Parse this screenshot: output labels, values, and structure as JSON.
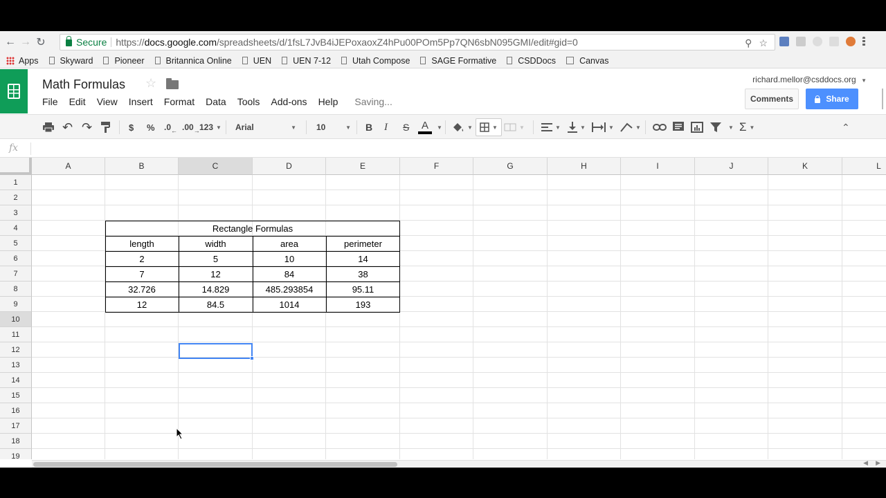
{
  "browser": {
    "secure_label": "Secure",
    "url_scheme": "https://",
    "url_domain": "docs.google.com",
    "url_path": "/spreadsheets/d/1fsL7JvB4iJEPoxaoxZ4hPu00POm5Pp7QN6sbN095GMI/edit#gid=0"
  },
  "bookmarks": [
    "Apps",
    "Skyward",
    "Pioneer",
    "Britannica Online",
    "UEN",
    "UEN 7-12",
    "Utah Compose",
    "SAGE Formative",
    "CSDDocs",
    "Canvas"
  ],
  "doc": {
    "title": "Math Formulas",
    "user_email": "richard.mellor@csddocs.org",
    "comments_label": "Comments",
    "share_label": "Share",
    "status": "Saving..."
  },
  "menu": [
    "File",
    "Edit",
    "View",
    "Insert",
    "Format",
    "Data",
    "Tools",
    "Add-ons",
    "Help"
  ],
  "toolbar": {
    "currency": "$",
    "percent": "%",
    "dec_less": ".0",
    "dec_more": ".00",
    "more_formats": "123",
    "font": "Arial",
    "font_size": "10",
    "bold": "B",
    "italic": "I",
    "strike": "S",
    "text_color": "A"
  },
  "formula_bar": {
    "fx": "fx"
  },
  "columns": [
    "A",
    "B",
    "C",
    "D",
    "E",
    "F",
    "G",
    "H",
    "I",
    "J",
    "K",
    "L"
  ],
  "rows": [
    "1",
    "2",
    "3",
    "4",
    "5",
    "6",
    "7",
    "8",
    "9",
    "10",
    "11",
    "12",
    "13",
    "14",
    "15",
    "16",
    "17",
    "18",
    "19"
  ],
  "selected_cell": "C10",
  "table": {
    "title": "Rectangle Formulas",
    "headers": [
      "length",
      "width",
      "area",
      "perimeter"
    ],
    "rows": [
      [
        "2",
        "5",
        "10",
        "14"
      ],
      [
        "7",
        "12",
        "84",
        "38"
      ],
      [
        "32.726",
        "14.829",
        "485.293854",
        "95.11"
      ],
      [
        "12",
        "84.5",
        "1014",
        "193"
      ]
    ]
  },
  "colors": {
    "accent": "#4285f4",
    "share": "#4d90fe",
    "sheets_green": "#0f9d58",
    "secure": "#0b8043"
  }
}
